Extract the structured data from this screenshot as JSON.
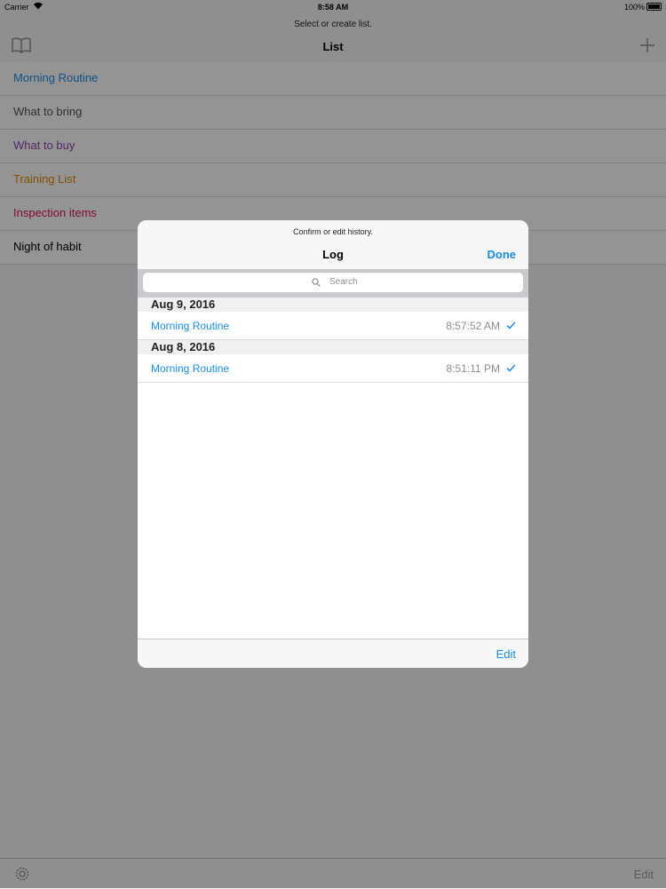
{
  "status_bar": {
    "carrier": "Carrier",
    "time": "8:58 AM",
    "battery": "100%"
  },
  "nav": {
    "prompt": "Select or create list.",
    "title": "List"
  },
  "lists": [
    {
      "label": "Morning Routine",
      "color": "#1a8ee6"
    },
    {
      "label": "What to bring",
      "color": "#555555"
    },
    {
      "label": "What to buy",
      "color": "#8e44ad"
    },
    {
      "label": "Training List",
      "color": "#e08a00"
    },
    {
      "label": "Inspection items",
      "color": "#e0145a"
    },
    {
      "label": "Night of habit",
      "color": "#000000"
    }
  ],
  "bottom_bar": {
    "edit_label": "Edit"
  },
  "modal": {
    "prompt": "Confirm or edit history.",
    "title": "Log",
    "done_label": "Done",
    "search_placeholder": "Search",
    "sections": [
      {
        "date": "Aug 9, 2016",
        "entries": [
          {
            "name": "Morning Routine",
            "time": "8:57:52 AM"
          }
        ]
      },
      {
        "date": "Aug 8, 2016",
        "entries": [
          {
            "name": "Morning Routine",
            "time": "8:51:11 PM"
          }
        ]
      }
    ],
    "edit_label": "Edit"
  },
  "colors": {
    "accent": "#1a8ee6"
  }
}
